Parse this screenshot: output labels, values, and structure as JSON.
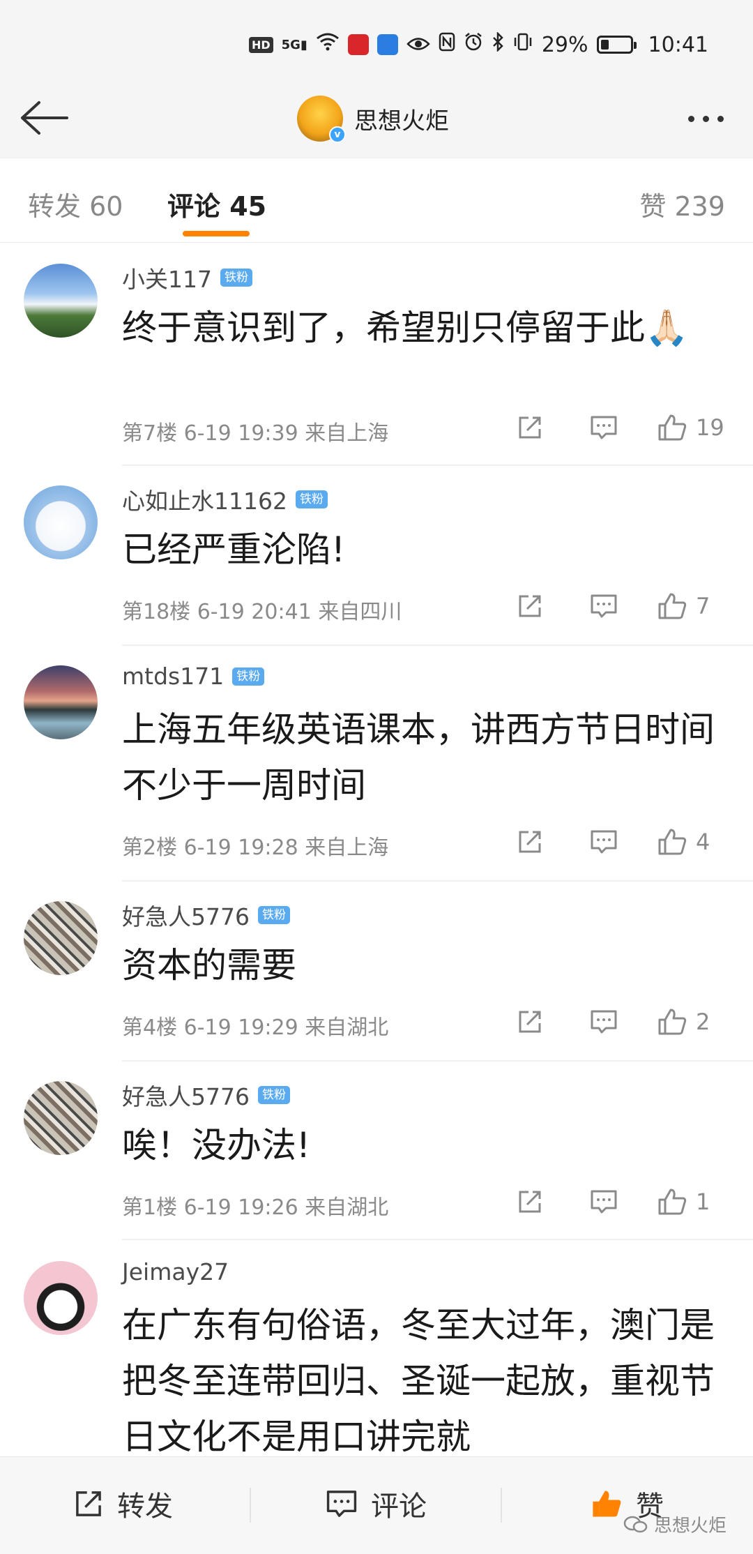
{
  "status_bar": {
    "hd": "HD",
    "signal": "5G",
    "battery_text": "29%",
    "battery_level": 0.29,
    "time": "10:41"
  },
  "nav": {
    "account_name": "思想火炬",
    "verified_mark": "v"
  },
  "tabs": [
    {
      "label": "转发 60"
    },
    {
      "label": "评论 45"
    },
    {
      "label": "赞 239"
    }
  ],
  "comments": [
    {
      "username": "小关117",
      "badge": "铁粉",
      "text": "终于意识到了，希望别只停留于此🙏🏻",
      "meta": "第7楼 6-19 19:39 来自上海",
      "likes": "19"
    },
    {
      "username": "心如止水11162",
      "badge": "铁粉",
      "text": "已经严重沦陷!",
      "meta": "第18楼 6-19 20:41 来自四川",
      "likes": "7"
    },
    {
      "username": "mtds171",
      "badge": "铁粉",
      "text": "上海五年级英语课本，讲西方节日时间不少于一周时间",
      "meta": "第2楼 6-19 19:28 来自上海",
      "likes": "4"
    },
    {
      "username": "好急人5776",
      "badge": "铁粉",
      "text": "资本的需要",
      "meta": "第4楼 6-19 19:29 来自湖北",
      "likes": "2"
    },
    {
      "username": "好急人5776",
      "badge": "铁粉",
      "text": "唉！没办法!",
      "meta": "第1楼 6-19 19:26 来自湖北",
      "likes": "1"
    },
    {
      "username": "Jeimay27",
      "badge": "",
      "text": "在广东有句俗语，冬至大过年，澳门是把冬至连带回归、圣诞一起放，重视节日文化不是用口讲完就",
      "meta": "",
      "likes": ""
    }
  ],
  "bottom_bar": {
    "repost_label": "转发",
    "comment_label": "评论",
    "like_label": "赞",
    "watermark": "思想火炬"
  },
  "colors": {
    "accent_orange": "#ff8200",
    "badge_blue": "#5aaaf0",
    "meta_gray": "#8a8a8a"
  }
}
